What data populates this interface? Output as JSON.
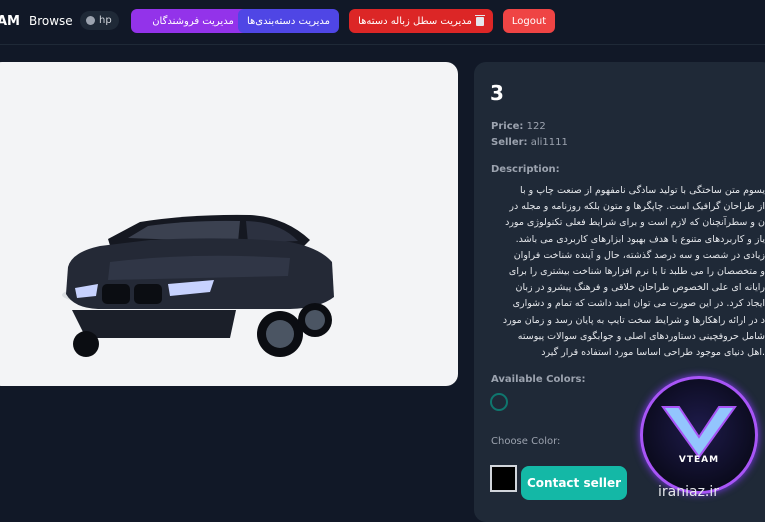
{
  "nav": {
    "brand": "AM",
    "browse": "Browse",
    "user": "hp",
    "sellers_button": "مدیریت فروشندگان",
    "categories_button": "مدیریت دسته‌بندی‌ها",
    "trash_button": "مدیریت سطل زباله دسته‌ها",
    "logout_button": "Logout"
  },
  "product": {
    "title": "3",
    "price_label": "Price:",
    "price": "122",
    "seller_label": "Seller:",
    "seller": "ali1111",
    "description_label": "Description:",
    "description": "یسوم متن ساختگی با تولید سادگی نامفهوم از صنعت چاپ و با\nاز طراحان گرافیک است. چاپگرها و متون بلکه روزنامه و مجله در\nن و سطرآنچنان که لازم است و برای شرایط فعلی تکنولوژی مورد\nیاز و کاربردهای متنوع با هدف بهبود ابزارهای کاربردی می باشد.\nزیادی در شصت و سه درصد گذشته، حال و آینده شناخت فراوان\nو متخصصان را می طلبد تا با نرم افزارها شناخت بیشتری را برای\nرایانه ای علی الخصوص طراحان خلاقی و فرهنگ پیشرو در زبان\nایجاد کرد. در این صورت می توان امید داشت که تمام و دشواری\nد در ارائه راهکارها و شرایط سخت تایپ به پایان رسد و زمان مورد\nشامل حروفچینی دستاوردهای اصلی و جوابگوی سوالات پیوسته\n.اهل دنیای موجود طراحی اساسا مورد استفاده قرار گیرد",
    "available_colors_label": "Available Colors:",
    "choose_color_label": "Choose Color:",
    "contact_button": "Contact seller",
    "swatch_color": "#0f766e",
    "chosen_color": "#000000"
  },
  "overlay": {
    "logo_text": "VTEAM",
    "watermark": "iraniaz.ir"
  }
}
